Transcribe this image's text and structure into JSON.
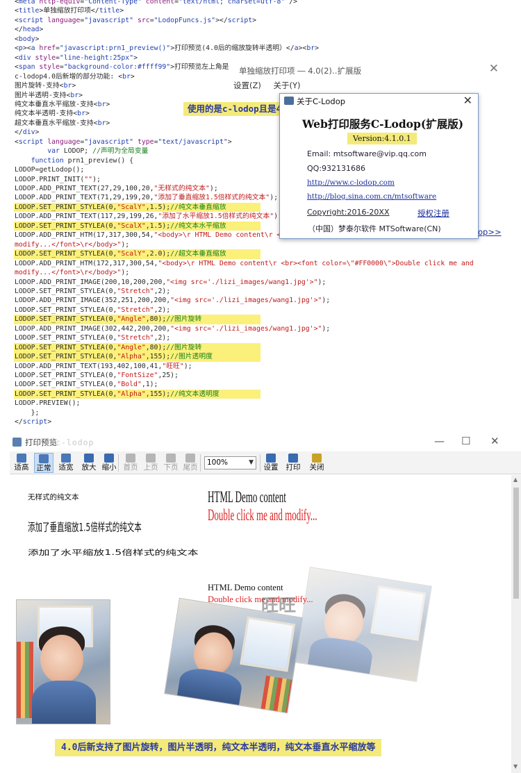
{
  "code": {
    "lines": [
      {
        "html": "&lt;<span class='k'>meta</span> <span class='at'>http-equiv</span>=<span class='av'>\"Content-Type\"</span> <span class='at'>content</span>=<span class='av'>\"text/html; charset=utf-8\"</span> /&gt;"
      },
      {
        "html": "&lt;<span class='k'>title</span>&gt;单独缩放打印项&lt;/<span class='k'>title</span>&gt;"
      },
      {
        "html": "&lt;<span class='k'>script</span> <span class='at'>language</span>=<span class='av'>\"javascript\"</span> <span class='at'>src</span>=<span class='av'>\"LodopFuncs.js\"</span>&gt;&lt;/<span class='k'>script</span>&gt;"
      },
      {
        "html": "&lt;/<span class='k'>head</span>&gt;"
      },
      {
        "html": "&lt;<span class='k'>body</span>&gt;"
      },
      {
        "html": "&lt;<span class='k'>p</span>&gt;&lt;<span class='k'>a</span> <span class='at'>href</span>=<span class='av'>\"javascript:prn1_preview()\"</span>&gt;打印预览(4.0后的缩放旋转半透明）&lt;/<span class='k'>a</span>&gt;&lt;<span class='k'>br</span>&gt;"
      },
      {
        "html": "&lt;<span class='k'>div</span> <span class='at'>style</span>=<span class='av'>\"line-height:25px\"</span>&gt;"
      },
      {
        "html": "&lt;<span class='k'>span</span> <span class='at'>style</span>=<span class='av'>\"background-color:#ffff99\"</span>&gt;打印预览左上角是小打印机图标，表明当前使用的是c-lodop&lt;/<span class='k'>span</span>&gt;&lt;<span class='k'>br</span>&gt;"
      },
      {
        "html": "c-lodop4.0后新增的部分功能: &lt;<span class='k'>br</span>&gt;"
      },
      {
        "html": "图片旋转-支持&lt;<span class='k'>br</span>&gt;"
      },
      {
        "html": "图片半透明-支持&lt;<span class='k'>br</span>&gt;"
      },
      {
        "html": "纯文本垂直水平缩放-支持&lt;<span class='k'>br</span>&gt;"
      },
      {
        "html": "纯文本半透明-支持&lt;<span class='k'>br</span>&gt;"
      },
      {
        "html": "超文本垂直水平缩放-支持&lt;<span class='k'>br</span>&gt;"
      },
      {
        "html": "&lt;/<span class='k'>div</span>&gt;"
      },
      {
        "html": "&lt;<span class='k'>script</span> <span class='at'>language</span>=<span class='av'>\"javascript\"</span> <span class='at'>type</span>=<span class='av'>\"text/javascript\"</span>&gt;"
      },
      {
        "html": "        <span class='k'>var</span> LODOP; <span class='c'>//声明为全局变量</span>"
      },
      {
        "html": "    <span class='k'>function</span> prn1_preview() {"
      },
      {
        "html": "LODOP=getLodop();"
      },
      {
        "html": "LODOP.PRINT_INIT(<span class='s'>\"\"</span>);"
      },
      {
        "html": "LODOP.ADD_PRINT_TEXT(27,29,100,20,<span class='s'>\"无样式的纯文本\"</span>);"
      },
      {
        "html": "LODOP.ADD_PRINT_TEXT(71,29,199,20,<span class='s'>\"添加了垂直缩放1.5倍样式的纯文本\"</span>);"
      },
      {
        "html": "LODOP.SET_PRINT_STYLEA(0,<span class='s'>\"ScalY\"</span>,1.5);<span class='c'>//纯文本垂直缩放</span>"
      },
      {
        "html": "LODOP.ADD_PRINT_TEXT(117,29,199,26,<span class='s'>\"添加了水平缩放1.5倍样式的纯文本\"</span>);"
      },
      {
        "html": "LODOP.SET_PRINT_STYLEA(0,<span class='s'>\"ScalX\"</span>,1.5);<span class='c'>//纯文本水平缩放</span>"
      },
      {
        "html": "LODOP.ADD_PRINT_HTM(17,317,300,54,<span class='s'>\"&lt;body&gt;\\r HTML Demo content\\r &lt;br&gt;&lt;font color=\\\"#FF0000\\\"&gt;Double click me and</span>"
      },
      {
        "html": "<span class='s'>modify...&lt;/font&gt;\\r&lt;/body&gt;\"</span>);"
      },
      {
        "html": "LODOP.SET_PRINT_STYLEA(0,<span class='s'>\"ScalY\"</span>,2.0);<span class='c'>//超文本垂直缩放</span>"
      },
      {
        "html": "LODOP.ADD_PRINT_HTM(172,317,300,54,<span class='s'>\"&lt;body&gt;\\r HTML Demo content\\r &lt;br&gt;&lt;font color=\\\"#FF0000\\\"&gt;Double click me and</span>"
      },
      {
        "html": "<span class='s'>modify...&lt;/font&gt;\\r&lt;/body&gt;\"</span>);"
      },
      {
        "html": "LODOP.ADD_PRINT_IMAGE(200,10,200,200,<span class='s'>\"&lt;img src='./lizi_images/wang1.jpg'&gt;\"</span>);"
      },
      {
        "html": "LODOP.SET_PRINT_STYLEA(0,<span class='s'>\"Stretch\"</span>,2);"
      },
      {
        "html": "LODOP.ADD_PRINT_IMAGE(352,251,200,200,<span class='s'>\"&lt;img src='./lizi_images/wang1.jpg'&gt;\"</span>);"
      },
      {
        "html": "LODOP.SET_PRINT_STYLEA(0,<span class='s'>\"Stretch\"</span>,2);"
      },
      {
        "html": "LODOP.SET_PRINT_STYLEA(0,<span class='s'>\"Angle\"</span>,80);<span class='c'>//图片旋转</span>"
      },
      {
        "html": "LODOP.ADD_PRINT_IMAGE(302,442,200,200,<span class='s'>\"&lt;img src='./lizi_images/wang1.jpg'&gt;\"</span>);"
      },
      {
        "html": "LODOP.SET_PRINT_STYLEA(0,<span class='s'>\"Stretch\"</span>,2);"
      },
      {
        "html": "LODOP.SET_PRINT_STYLEA(0,<span class='s'>\"Angle\"</span>,80);<span class='c'>//图片旋转</span>"
      },
      {
        "html": "LODOP.SET_PRINT_STYLEA(0,<span class='s'>\"Alpha\"</span>,155);<span class='c'>//图片透明度</span>"
      },
      {
        "html": "LODOP.ADD_PRINT_TEXT(193,402,100,41,<span class='s'>\"旺旺\"</span>);"
      },
      {
        "html": "LODOP.SET_PRINT_STYLEA(0,<span class='s'>\"FontSize\"</span>,25);"
      },
      {
        "html": "LODOP.SET_PRINT_STYLEA(0,<span class='s'>\"Bold\"</span>,1);"
      },
      {
        "html": "LODOP.SET_PRINT_STYLEA(0,<span class='s'>\"Alpha\"</span>,155);<span class='c'>//纯文本透明度</span>"
      },
      {
        "html": "LODOP.PREVIEW();"
      },
      {
        "html": "    };"
      },
      {
        "html": "&lt;/<span class='k'>script</span>&gt;"
      }
    ],
    "highlighted_lines": [
      22,
      24,
      27,
      34,
      37,
      38,
      42
    ]
  },
  "annotation_top": "使用的是c-lodop且是4.0后的版本",
  "bg_window": {
    "title": "单独缩放打印项 ― 4.0(2)‥扩展版",
    "menu": [
      "设置(Z)",
      "关于(Y)"
    ]
  },
  "about_dialog": {
    "title": "关于C-Lodop",
    "close": "✕",
    "heading": "Web打印服务C-Lodop(扩展版)",
    "version": "Version:4.1.0.1",
    "email": "Email: mtsoftware@vip.qq.com",
    "qq": "QQ:932131686",
    "link1": "http://www.c-lodop.com",
    "link2": "http://blog.sina.com.cn/mtsoftware",
    "copyright": "Copyright:2016-20XX",
    "register": "授权注册",
    "company": "（中国）梦泰尔软件 MTSoftware(CN)"
  },
  "link_tail": "op>>",
  "preview": {
    "title": "打印预览",
    "brand": "c-lodop",
    "window_buttons": [
      "—",
      "☐",
      "✕"
    ],
    "toolbar": [
      {
        "label": "适高",
        "enabled": true,
        "active": false,
        "icon": "fit-height-icon",
        "color": "#4a78b8"
      },
      {
        "label": "正常",
        "enabled": true,
        "active": true,
        "icon": "normal-size-icon",
        "color": "#4a78b8"
      },
      {
        "label": "适宽",
        "enabled": true,
        "active": false,
        "icon": "fit-width-icon",
        "color": "#4a78b8"
      },
      {
        "label": "放大",
        "enabled": true,
        "active": false,
        "icon": "zoom-in-icon",
        "color": "#3a6ab0"
      },
      {
        "label": "缩小",
        "enabled": true,
        "active": false,
        "icon": "zoom-out-icon",
        "color": "#3a6ab0"
      },
      {
        "label": "首页",
        "enabled": false,
        "active": false,
        "icon": "first-page-icon",
        "color": "#b5b5b5"
      },
      {
        "label": "上页",
        "enabled": false,
        "active": false,
        "icon": "prev-page-icon",
        "color": "#b5b5b5"
      },
      {
        "label": "下页",
        "enabled": false,
        "active": false,
        "icon": "next-page-icon",
        "color": "#b5b5b5"
      },
      {
        "label": "尾页",
        "enabled": false,
        "active": false,
        "icon": "last-page-icon",
        "color": "#b5b5b5"
      }
    ],
    "zoom_value": "100%",
    "toolbar2": [
      {
        "label": "设置",
        "icon": "settings-icon",
        "color": "#3a6ab0"
      },
      {
        "label": "打印",
        "icon": "printer-icon",
        "color": "#3a6ab0"
      },
      {
        "label": "关闭",
        "icon": "close-door-icon",
        "color": "#c9a227"
      }
    ],
    "page": {
      "text_plain": "无样式的纯文本",
      "text_scaly": "添加了垂直缩放1.5倍样式的纯文本",
      "text_scalx": "添加了水平缩放1.5倍样式的纯文本",
      "htm1_line1": "HTML Demo content",
      "htm1_line2": "Double click me and modify...",
      "htm2_line1": "HTML Demo content",
      "htm2_line2": "Double click me and modify...",
      "wangwang": "旺旺"
    }
  },
  "annotation_bottom": "4.0后新支持了图片旋转，图片半透明，纯文本半透明，纯文本垂直水平缩放等"
}
